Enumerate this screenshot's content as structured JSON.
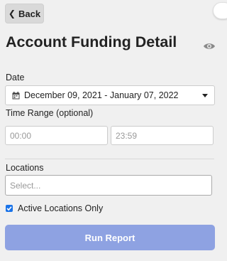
{
  "header": {
    "back_label": "Back",
    "title": "Account Funding Detail"
  },
  "date": {
    "label": "Date",
    "value": "December 09, 2021 - January 07, 2022"
  },
  "time_range": {
    "label": "Time Range (optional)",
    "start_placeholder": "00:00",
    "end_placeholder": "23:59"
  },
  "locations": {
    "label": "Locations",
    "placeholder": "Select...",
    "active_only_label": "Active Locations Only",
    "active_only_checked": true
  },
  "actions": {
    "run_label": "Run Report"
  },
  "colors": {
    "background": "#f0f0f0",
    "run_button": "#8ea2e2",
    "checkbox": "#1a73e8"
  }
}
